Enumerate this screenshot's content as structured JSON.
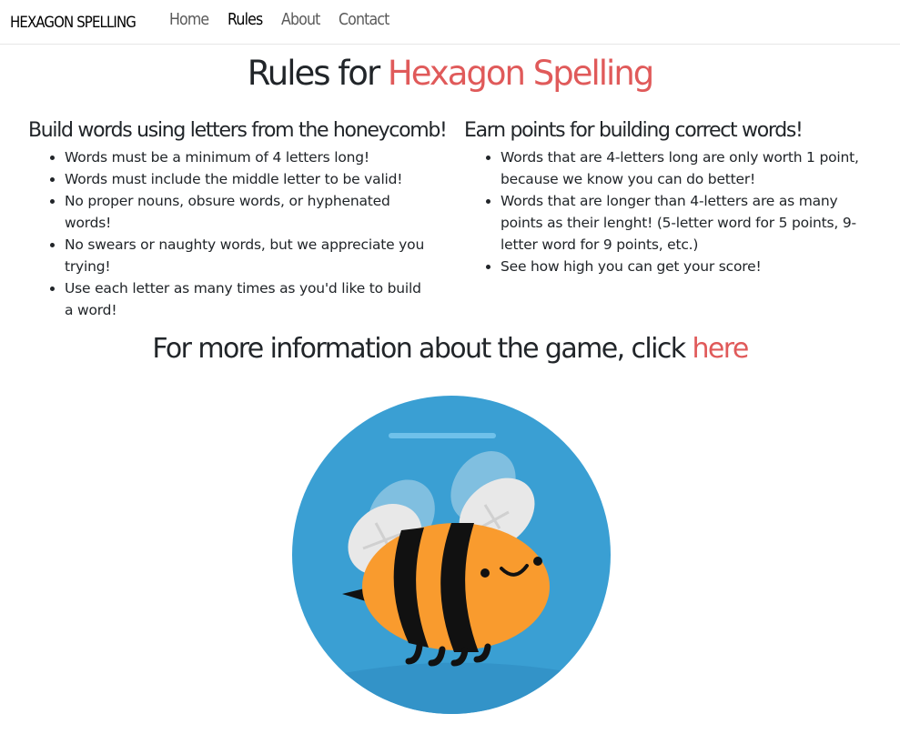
{
  "nav": {
    "brand": "HEXAGON SPELLING",
    "links": [
      {
        "label": "Home",
        "active": false
      },
      {
        "label": "Rules",
        "active": true
      },
      {
        "label": "About",
        "active": false
      },
      {
        "label": "Contact",
        "active": false
      }
    ]
  },
  "title": {
    "prefix": "Rules for ",
    "highlight": "Hexagon Spelling"
  },
  "left_column": {
    "heading": "Build words using letters from the honeycomb!",
    "items": [
      "Words must be a minimum of 4 letters long!",
      "Words must include the middle letter to be valid!",
      "No proper nouns, obsure words, or hyphenated words!",
      "No swears or naughty words, but we appreciate you trying!",
      "Use each letter as many times as you'd like to build a word!"
    ]
  },
  "right_column": {
    "heading": "Earn points for building correct words!",
    "items": [
      "Words that are 4-letters long are only worth 1 point, because we know you can do better!",
      "Words that are longer than 4-letters are as many points as their lenght! (5-letter word for 5 points, 9-letter word for 9 points, etc.)",
      "See how high you can get your score!"
    ]
  },
  "more_info": {
    "text": "For more information about the game, click ",
    "link": "here"
  },
  "colors": {
    "accent": "#e05a5a",
    "bee_background": "#3a9fd3",
    "bee_body": "#f99b2e"
  },
  "image": {
    "icon": "bee-illustration"
  }
}
